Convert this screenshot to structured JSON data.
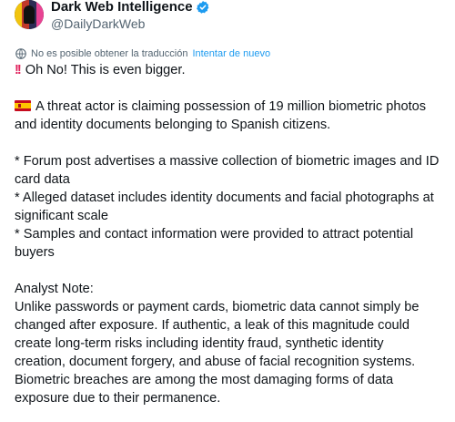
{
  "author": {
    "display_name": "Dark Web Intelligence",
    "handle": "@DailyDarkWeb",
    "verified_icon": "verified-badge-icon",
    "verified_color": "#1d9bf0"
  },
  "translation": {
    "notice": "No es posible obtener la traducción",
    "retry_label": "Intentar de nuevo"
  },
  "tweet": {
    "headline_icon": "double-exclamation-icon",
    "headline": "Oh No! This is even bigger.",
    "flag_icon": "spain-flag-icon",
    "intro_line1": "A threat actor is claiming possession of 19 million biometric photos",
    "intro_line2": "and identity documents belonging to Spanish citizens.",
    "bullet1_line1": "* Forum post advertises a massive collection of biometric images and ID",
    "bullet1_line2": "card data",
    "bullet2_line1": "* Alleged dataset includes identity documents and facial photographs at",
    "bullet2_line2": "significant scale",
    "bullet3_line1": "* Samples and contact information were provided to attract potential",
    "bullet3_line2": "buyers",
    "note_title": "Analyst Note:",
    "note_line1": "Unlike passwords or payment cards, biometric data cannot simply be",
    "note_line2": "changed after exposure. If authentic, a leak of this magnitude could",
    "note_line3": "create long-term risks including identity fraud, synthetic identity",
    "note_line4": "creation, document forgery, and abuse of facial recognition systems.",
    "note_line5": "Biometric breaches are among the most damaging forms of data",
    "note_line6": "exposure due to their permanence."
  },
  "colors": {
    "text": "#0f1419",
    "secondary": "#536471",
    "link": "#1d9bf0",
    "alert": "#e0245e"
  }
}
